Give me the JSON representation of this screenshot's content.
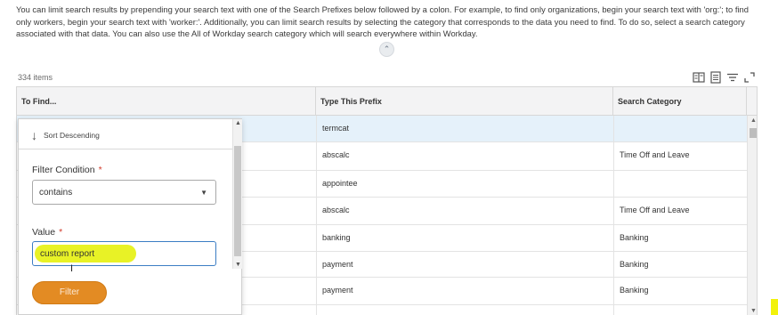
{
  "intro_text": "You can limit search results by prepending your search text with one of the Search Prefixes below followed by a colon. For example, to find only organizations, begin your search text with 'org:'; to find only workers, begin your search text with 'worker:'. Additionally, you can limit search results by selecting the category that corresponds to the data you need to find. To do so, select a search category associated with that data. You can also use the All of Workday search category which will search everywhere within Workday.",
  "items_count": "334 items",
  "toolbar": {
    "icons": [
      "column-settings-icon",
      "list-view-icon",
      "filter-lines-icon",
      "expand-icon"
    ]
  },
  "table": {
    "headers": {
      "to_find": "To Find...",
      "prefix": "Type This Prefix",
      "category": "Search Category"
    },
    "rows": [
      {
        "prefix": "termcat",
        "category": ""
      },
      {
        "prefix": "abscalc",
        "category": "Time Off and Leave"
      },
      {
        "prefix": "appointee",
        "category": ""
      },
      {
        "prefix": "abscalc",
        "category": "Time Off and Leave"
      },
      {
        "prefix": "banking",
        "category": "Banking"
      },
      {
        "prefix": "payment",
        "category": "Banking"
      },
      {
        "prefix": "payment",
        "category": "Banking"
      }
    ]
  },
  "popover": {
    "sort_label": "Sort Descending",
    "filter_condition_label": "Filter Condition",
    "filter_condition_value": "contains",
    "value_label": "Value",
    "value_text": "custom report",
    "required_mark": "*",
    "filter_button": "Filter"
  },
  "colors": {
    "accent_orange": "#e38b23",
    "highlight_yellow": "#e8f226",
    "selected_row": "#e5f1fa",
    "focus_blue": "#3b7dc4"
  }
}
